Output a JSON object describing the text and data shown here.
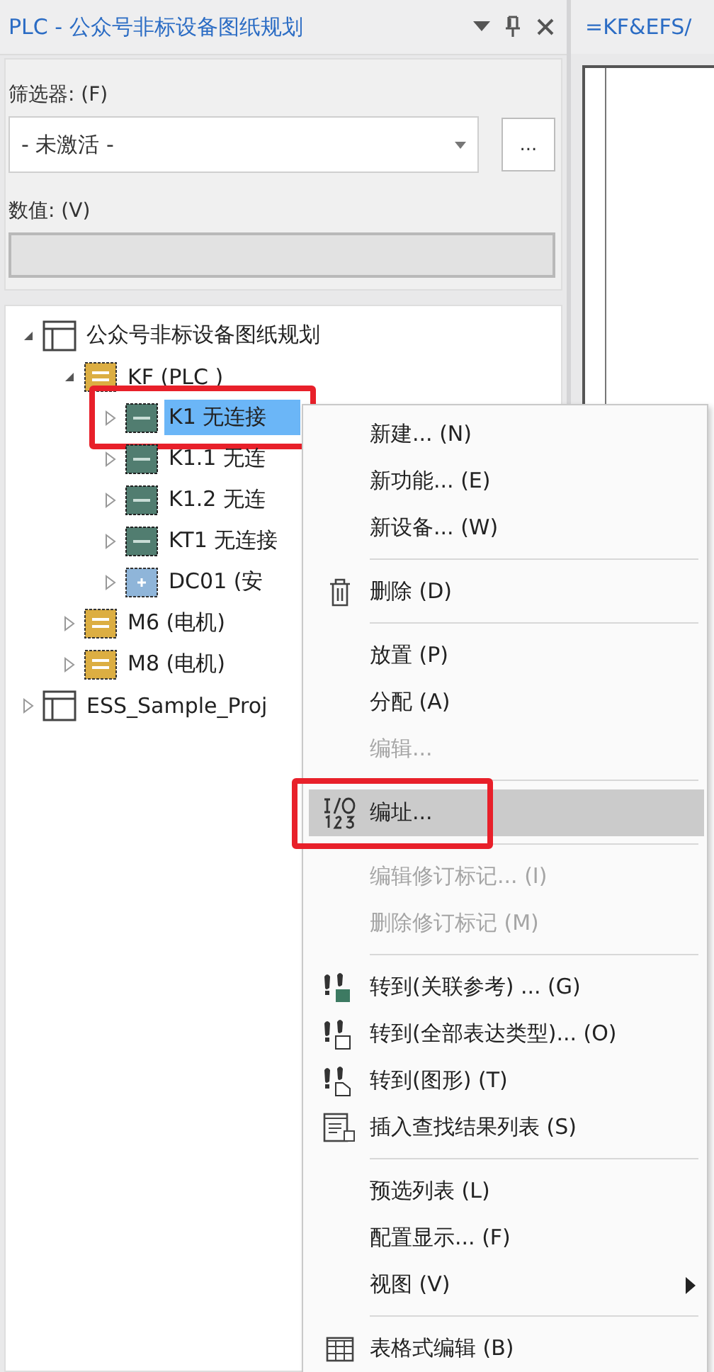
{
  "panel": {
    "title": "PLC - 公众号非标设备图纸规划"
  },
  "filter": {
    "label": "筛选器: (F)",
    "value": "- 未激活 -",
    "more_button": "...",
    "value_label": "数值: (V)",
    "value_field_disabled": true
  },
  "tree": [
    {
      "label": "公众号非标设备图纸规划",
      "kind": "project",
      "expanded": true,
      "selected": false,
      "marked": false,
      "children": [
        {
          "label": "KF (PLC )",
          "kind": "group",
          "expanded": true,
          "selected": false,
          "marked": false,
          "children": [
            {
              "label": "K1 无连接",
              "kind": "plc",
              "expanded": false,
              "selected": true,
              "marked": true
            },
            {
              "label": "K1.1 无连",
              "kind": "plc",
              "expanded": false,
              "selected": false,
              "marked": false
            },
            {
              "label": "K1.2 无连",
              "kind": "plc",
              "expanded": false,
              "selected": false,
              "marked": false
            },
            {
              "label": "KT1 无连接",
              "kind": "plc",
              "expanded": false,
              "selected": false,
              "marked": false
            },
            {
              "label": "DC01 (安",
              "kind": "dc",
              "expanded": false,
              "selected": false,
              "marked": false
            }
          ]
        },
        {
          "label": "M6 (电机)",
          "kind": "group",
          "expanded": false,
          "selected": false,
          "marked": false
        },
        {
          "label": "M8 (电机)",
          "kind": "group",
          "expanded": false,
          "selected": false,
          "marked": false
        }
      ]
    },
    {
      "label": "ESS_Sample_Proj",
      "kind": "project",
      "expanded": false,
      "selected": false,
      "marked": false
    }
  ],
  "document_tab": {
    "title": "=KF&EFS/"
  },
  "context_menu": [
    {
      "kind": "item",
      "label": "新建... (N)",
      "disabled": false,
      "hovered": false,
      "marked": false
    },
    {
      "kind": "item",
      "label": "新功能... (E)",
      "disabled": false,
      "hovered": false,
      "marked": false
    },
    {
      "kind": "item",
      "label": "新设备... (W)",
      "disabled": false,
      "hovered": false,
      "marked": false
    },
    {
      "kind": "separator"
    },
    {
      "kind": "delete",
      "label": "删除 (D)",
      "disabled": false,
      "hovered": false,
      "marked": false
    },
    {
      "kind": "separator"
    },
    {
      "kind": "item",
      "label": "放置 (P)",
      "disabled": false,
      "hovered": false,
      "marked": false
    },
    {
      "kind": "item",
      "label": "分配 (A)",
      "disabled": false,
      "hovered": false,
      "marked": false
    },
    {
      "kind": "item",
      "label": "编辑...",
      "disabled": true,
      "hovered": false,
      "marked": false
    },
    {
      "kind": "separator"
    },
    {
      "kind": "address",
      "label": "编址...",
      "disabled": false,
      "hovered": true,
      "marked": true
    },
    {
      "kind": "separator"
    },
    {
      "kind": "item",
      "label": "编辑修订标记... (I)",
      "disabled": true,
      "hovered": false,
      "marked": false
    },
    {
      "kind": "item",
      "label": "删除修订标记 (M)",
      "disabled": true,
      "hovered": false,
      "marked": false
    },
    {
      "kind": "separator"
    },
    {
      "kind": "goto-ref",
      "label": "转到(关联参考) ... (G)",
      "disabled": false,
      "hovered": false,
      "marked": false
    },
    {
      "kind": "goto-all",
      "label": "转到(全部表达类型)... (O)",
      "disabled": false,
      "hovered": false,
      "marked": false
    },
    {
      "kind": "goto-graphic",
      "label": "转到(图形) (T)",
      "disabled": false,
      "hovered": false,
      "marked": false
    },
    {
      "kind": "insert-list",
      "label": "插入查找结果列表 (S)",
      "disabled": false,
      "hovered": false,
      "marked": false
    },
    {
      "kind": "separator"
    },
    {
      "kind": "item",
      "label": "预选列表 (L)",
      "disabled": false,
      "hovered": false,
      "marked": false
    },
    {
      "kind": "item",
      "label": "配置显示... (F)",
      "disabled": false,
      "hovered": false,
      "marked": false
    },
    {
      "kind": "submenu",
      "label": "视图 (V)",
      "disabled": false,
      "hovered": false,
      "marked": false
    },
    {
      "kind": "separator"
    },
    {
      "kind": "table-edit",
      "label": "表格式编辑 (B)",
      "disabled": false,
      "hovered": false,
      "marked": false
    }
  ]
}
